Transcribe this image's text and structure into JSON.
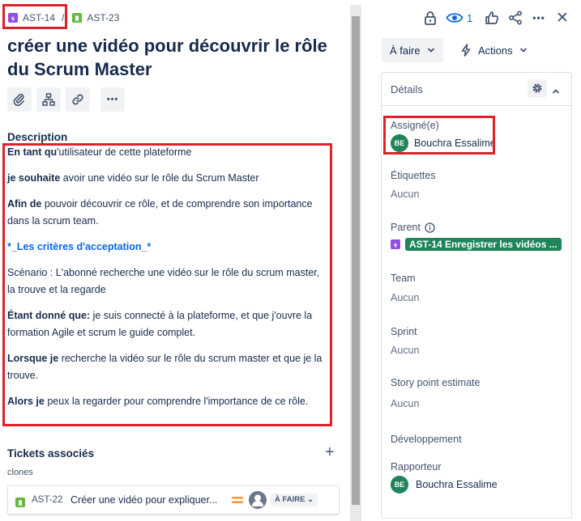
{
  "breadcrumb": {
    "parent_key": "AST-14",
    "separator": "/",
    "issue_key": "AST-23"
  },
  "issue": {
    "title": "créer une vidéo pour découvrir le rôle du Scrum Master"
  },
  "toolbar": {
    "attach_icon": "paperclip-icon",
    "child_icon": "hierarchy-icon",
    "link_icon": "link-icon",
    "more_icon": "more-icon",
    "more_label": "•••"
  },
  "description": {
    "heading": "Description",
    "p1_bold": "En tant qu",
    "p1_rest": "'utilisateur de cette plateforme",
    "p2_bold": "je souhaite",
    "p2_rest": " avoir une vidéo sur le rôle du Scrum Master",
    "p3_bold": "Afin de",
    "p3_rest": " pouvoir découvrir ce rôle, et de comprendre son importance dans la scrum team.",
    "p4_link": "*_Les critères d'acceptation_*",
    "p5": "Scénario : L'abonné recherche une vidéo sur le rôle du scrum master, la trouve et la regarde",
    "p6_bold": " Étant donné que:",
    "p6_rest": " je suis connecté à la plateforme, et que j'ouvre la formation Agile et scrum le guide complet.",
    "p7_bold": "Lorsque je",
    "p7_rest": " recherche la vidéo sur le rôle du scrum master et que je la trouve.",
    "p8_bold": "Alors je",
    "p8_rest": " peux la regarder pour comprendre l'importance de ce rôle."
  },
  "linked": {
    "heading": "Tickets associés",
    "add_label": "+",
    "relation": "clones",
    "item_key": "AST-22",
    "item_summary": "Créer une vidéo pour expliquer...",
    "item_status": "À FAIRE",
    "priority_icon": "priority-medium-icon"
  },
  "topbar": {
    "lock_icon": "lock-icon",
    "watch_icon": "eye-icon",
    "watch_count": "1",
    "like_icon": "thumbs-up-icon",
    "share_icon": "share-icon",
    "more_label": "•••",
    "close_label": "✕"
  },
  "status_button": {
    "label": "À faire",
    "chevron": "⌄"
  },
  "actions_button": {
    "label": "Actions",
    "chevron": "⌄"
  },
  "details": {
    "heading": "Détails",
    "gear_icon": "gear-icon",
    "collapse_chevron": "˄",
    "assignee_label": "Assigné(e)",
    "assignee_initials": "BE",
    "assignee_name": "Bouchra Essalime",
    "labels_label": "Étiquettes",
    "labels_value": "Aucun",
    "parent_label": "Parent",
    "parent_value": "AST-14 Enregistrer les vidéos ...",
    "team_label": "Team",
    "team_value": "Aucun",
    "sprint_label": "Sprint",
    "sprint_value": "Aucun",
    "sp_label": "Story point estimate",
    "sp_value": "Aucun",
    "dev_label": "Développement",
    "reporter_label": "Rapporteur",
    "reporter_initials": "BE",
    "reporter_name": "Bouchra Essalime"
  },
  "colors": {
    "highlight_border": "#e0202a",
    "epic": "#904ee2",
    "story": "#63ba3c",
    "avatar": "#1f845a",
    "link": "#0c66e4"
  }
}
